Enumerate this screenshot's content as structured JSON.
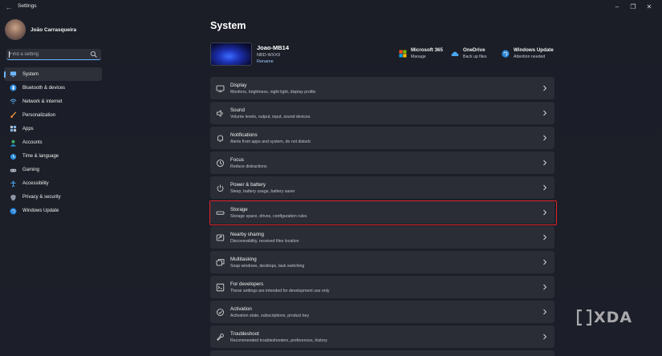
{
  "window": {
    "title": "Settings"
  },
  "profile": {
    "name": "João Carrasqueira"
  },
  "search": {
    "placeholder": "Find a setting"
  },
  "sidebar": {
    "items": [
      {
        "label": "System",
        "icon": "monitor-icon"
      },
      {
        "label": "Bluetooth & devices",
        "icon": "bluetooth-icon"
      },
      {
        "label": "Network & internet",
        "icon": "wifi-icon"
      },
      {
        "label": "Personalization",
        "icon": "brush-icon"
      },
      {
        "label": "Apps",
        "icon": "apps-icon"
      },
      {
        "label": "Accounts",
        "icon": "person-icon"
      },
      {
        "label": "Time & language",
        "icon": "globe-clock-icon"
      },
      {
        "label": "Gaming",
        "icon": "gamepad-icon"
      },
      {
        "label": "Accessibility",
        "icon": "accessibility-icon"
      },
      {
        "label": "Privacy & security",
        "icon": "shield-icon"
      },
      {
        "label": "Windows Update",
        "icon": "update-icon"
      }
    ]
  },
  "main": {
    "title": "System",
    "device": {
      "name": "Joao-MB14",
      "model": "NBD-WXX9",
      "rename": "Rename"
    },
    "quick": [
      {
        "title": "Microsoft 365",
        "sub": "Manage",
        "icon": "microsoft-icon"
      },
      {
        "title": "OneDrive",
        "sub": "Back up files",
        "icon": "cloud-icon"
      },
      {
        "title": "Windows Update",
        "sub": "Attention needed",
        "icon": "update-icon"
      }
    ],
    "cards": [
      {
        "title": "Display",
        "sub": "Monitors, brightness, night light, display profile",
        "icon": "display-icon"
      },
      {
        "title": "Sound",
        "sub": "Volume levels, output, input, sound devices",
        "icon": "speaker-icon"
      },
      {
        "title": "Notifications",
        "sub": "Alerts from apps and system, do not disturb",
        "icon": "bell-icon"
      },
      {
        "title": "Focus",
        "sub": "Reduce distractions",
        "icon": "focus-icon"
      },
      {
        "title": "Power & battery",
        "sub": "Sleep, battery usage, battery saver",
        "icon": "power-icon"
      },
      {
        "title": "Storage",
        "sub": "Storage space, drives, configuration rules",
        "icon": "storage-icon"
      },
      {
        "title": "Nearby sharing",
        "sub": "Discoverability, received files location",
        "icon": "share-icon"
      },
      {
        "title": "Multitasking",
        "sub": "Snap windows, desktops, task switching",
        "icon": "multitask-icon"
      },
      {
        "title": "For developers",
        "sub": "These settings are intended for development use only",
        "icon": "developer-icon"
      },
      {
        "title": "Activation",
        "sub": "Activation state, subscriptions, product key",
        "icon": "check-circle-icon"
      },
      {
        "title": "Troubleshoot",
        "sub": "Recommended troubleshooters, preferences, history",
        "icon": "wrench-icon"
      }
    ]
  },
  "watermark": {
    "text": "XDA"
  },
  "colors": {
    "accent": "#6fb7ff",
    "highlight": "#e0242c",
    "card": "#2a2d36"
  }
}
